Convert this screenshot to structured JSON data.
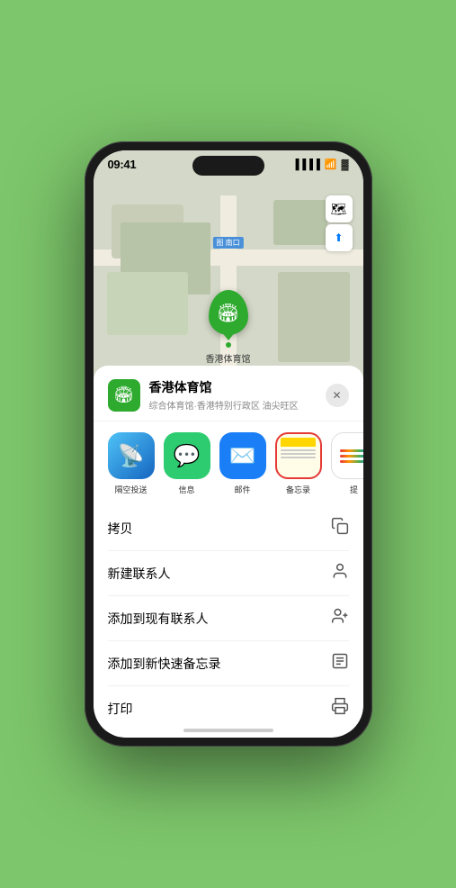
{
  "statusBar": {
    "time": "09:41",
    "signal": "●●●●",
    "wifi": "WiFi",
    "battery": "Battery"
  },
  "map": {
    "entrance_label": "南口",
    "entrance_prefix": "图",
    "marker_label": "香港体育馆"
  },
  "mapControls": {
    "layers_icon": "🗺",
    "location_icon": "⬆"
  },
  "venueCard": {
    "name": "香港体育馆",
    "subtitle": "综合体育馆·香港特别行政区 油尖旺区",
    "close_icon": "✕"
  },
  "shareApps": [
    {
      "id": "airdrop",
      "label": "隔空投送",
      "type": "airdrop"
    },
    {
      "id": "message",
      "label": "信息",
      "type": "message"
    },
    {
      "id": "mail",
      "label": "邮件",
      "type": "mail"
    },
    {
      "id": "notes",
      "label": "备忘录",
      "type": "notes"
    },
    {
      "id": "more",
      "label": "提",
      "type": "more"
    }
  ],
  "actions": [
    {
      "id": "copy",
      "label": "拷贝",
      "icon": "copy"
    },
    {
      "id": "new-contact",
      "label": "新建联系人",
      "icon": "person"
    },
    {
      "id": "add-existing",
      "label": "添加到现有联系人",
      "icon": "person-add"
    },
    {
      "id": "add-notes",
      "label": "添加到新快速备忘录",
      "icon": "note"
    },
    {
      "id": "print",
      "label": "打印",
      "icon": "print"
    }
  ]
}
